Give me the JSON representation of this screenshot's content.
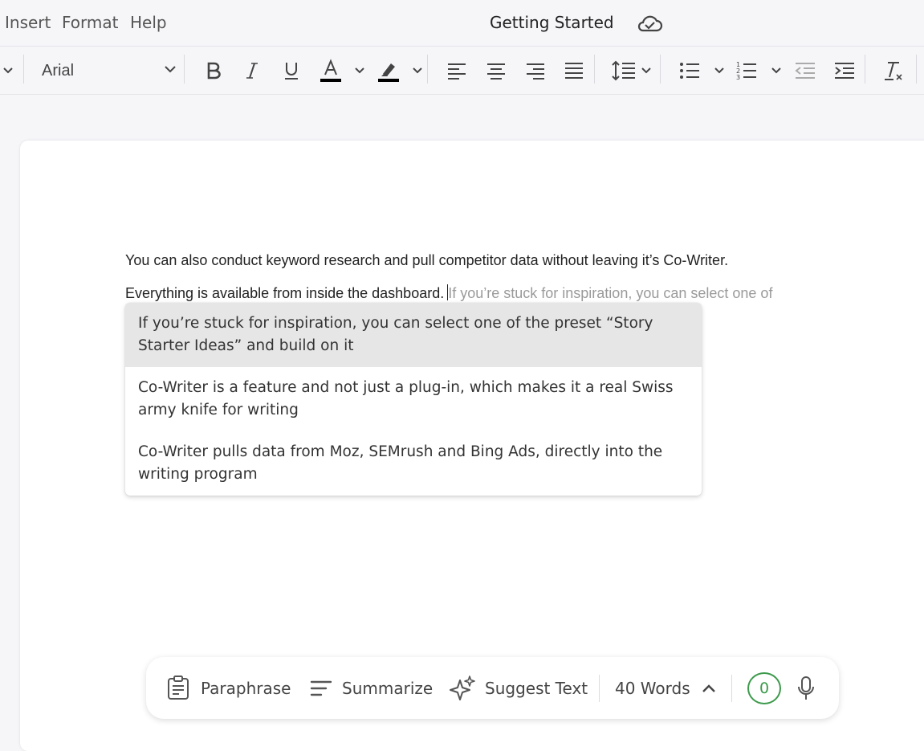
{
  "menu": {
    "items": [
      "Insert",
      "Format",
      "Help"
    ],
    "doc_title": "Getting Started"
  },
  "toolbar": {
    "font": "Arial"
  },
  "document": {
    "line1": "You can also conduct keyword research and pull competitor data without leaving it’s Co-Writer.",
    "line2": "Everything is available from inside the dashboard.",
    "ghost_text": "If you’re stuck for inspiration, you can select one of"
  },
  "suggestions": [
    "If you’re stuck for inspiration, you can select one of the preset “Story Starter Ideas” and build on it",
    "Co-Writer is a feature and not just a plug-in, which makes it a real Swiss army knife for writing",
    "Co-Writer pulls data from Moz, SEMrush and Bing Ads, directly into the writing program"
  ],
  "bottom_bar": {
    "paraphrase": "Paraphrase",
    "summarize": "Summarize",
    "suggest_text": "Suggest Text",
    "word_count": "40 Words",
    "score": "0"
  },
  "colors": {
    "accent_green": "#3c9a4b",
    "text_color_bar": "#000000"
  }
}
